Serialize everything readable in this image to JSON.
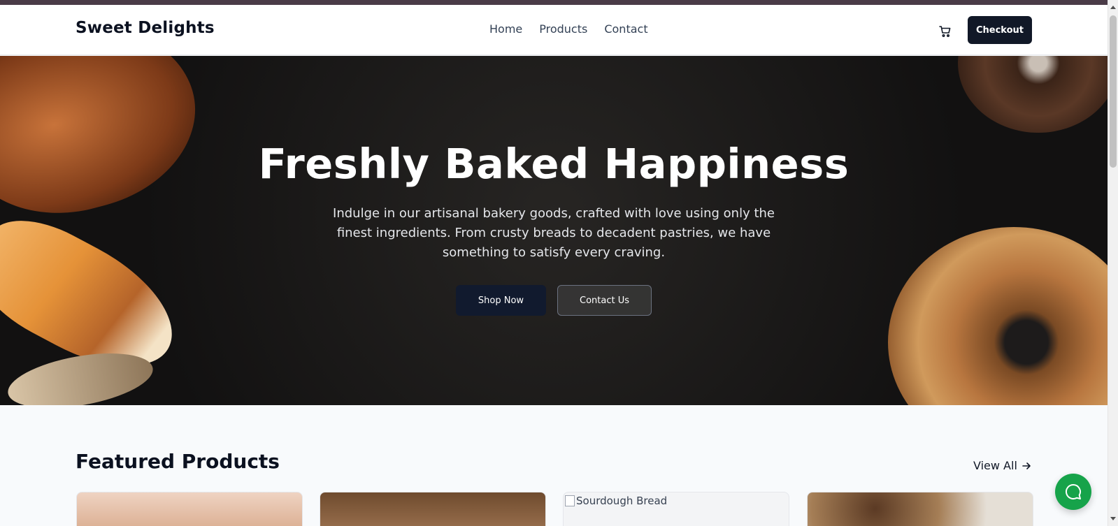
{
  "navbar": {
    "brand": "Sweet Delights",
    "links": [
      "Home",
      "Products",
      "Contact"
    ],
    "cart_icon": "shopping-cart-icon",
    "checkout_label": "Checkout"
  },
  "hero": {
    "title": "Freshly Baked Happiness",
    "subtitle": "Indulge in our artisanal bakery goods, crafted with love using only the finest ingredients. From crusty breads to decadent pastries, we have something to satisfy every craving.",
    "primary_button": "Shop Now",
    "secondary_button": "Contact Us"
  },
  "featured": {
    "title": "Featured Products",
    "view_all_label": "View All",
    "arrow_icon": "arrow-right-icon",
    "products": [
      {
        "image_alt": ""
      },
      {
        "image_alt": ""
      },
      {
        "image_alt": "Sourdough Bread"
      },
      {
        "image_alt": ""
      }
    ]
  },
  "chat": {
    "icon": "chat-bubble-icon"
  },
  "colors": {
    "primary": "#111827",
    "chat_button": "#16a34a",
    "hero_background": "#1d1b1b",
    "page_background": "#f8fafc"
  }
}
